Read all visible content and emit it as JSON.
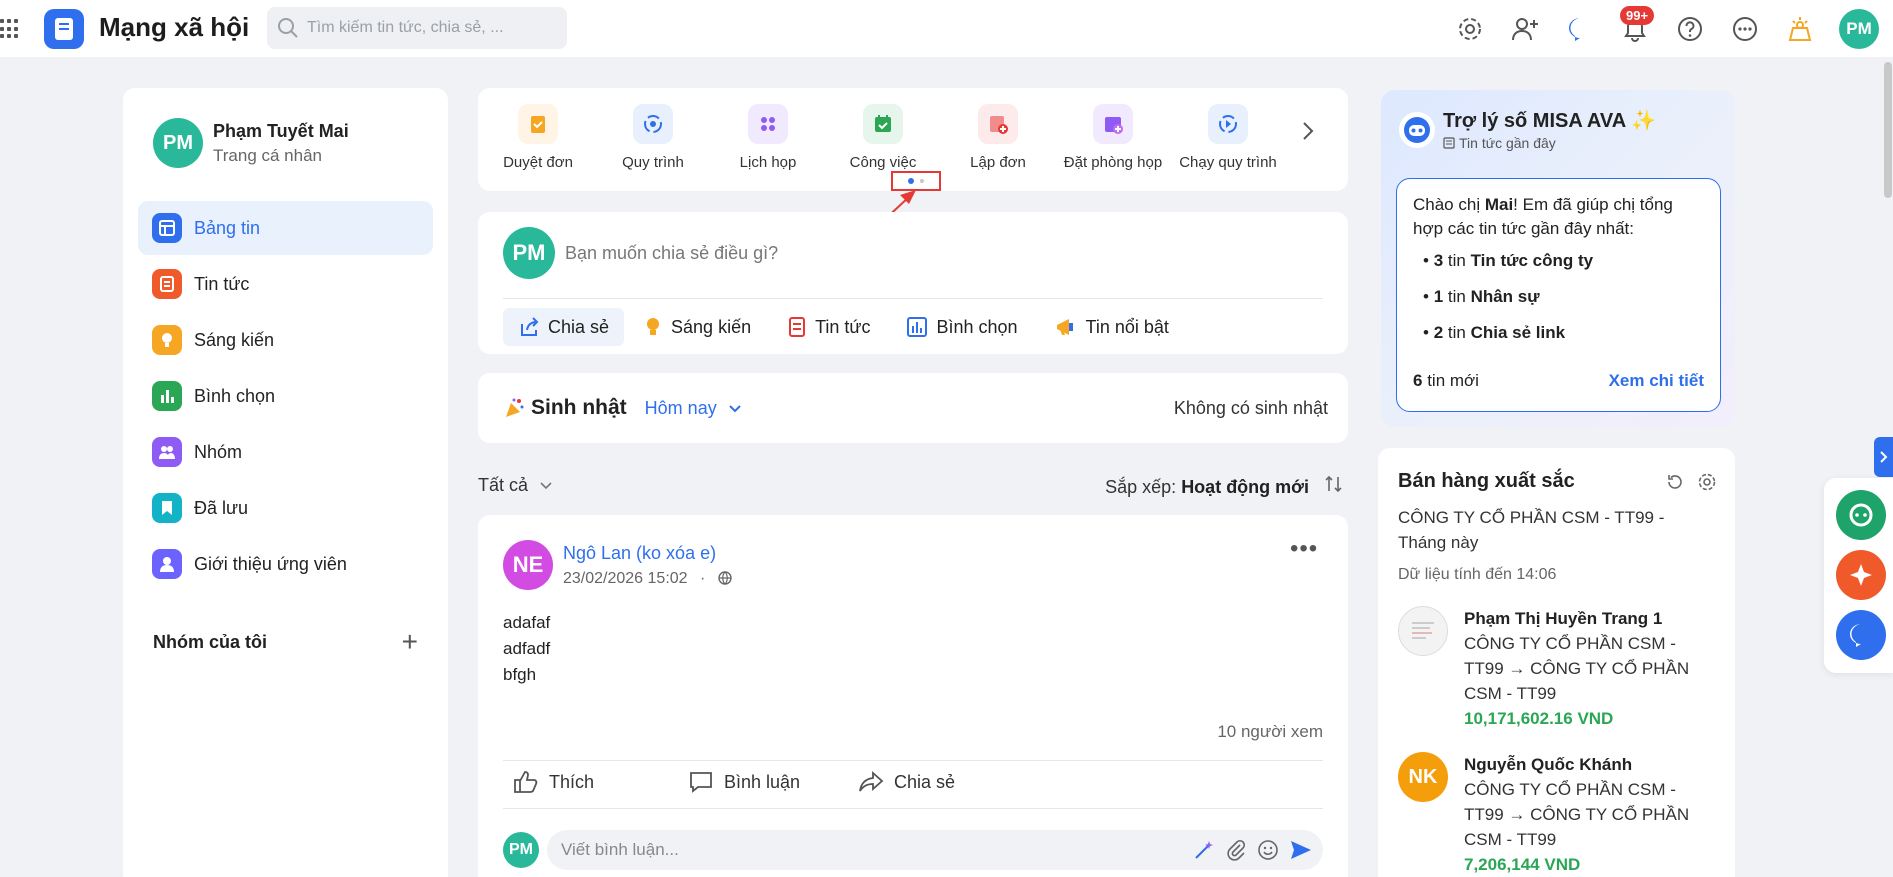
{
  "header": {
    "app_title": "Mạng xã hội",
    "search_placeholder": "Tìm kiếm tin tức, chia sẻ, ...",
    "notification_badge": "99+",
    "user_initials": "PM",
    "icons": [
      "apps-grid-icon",
      "settings-icon",
      "add-user-icon",
      "chat-icon",
      "bell-icon",
      "help-icon",
      "more-icon",
      "broadcast-icon"
    ]
  },
  "sidebar": {
    "profile": {
      "initials": "PM",
      "name": "Phạm Tuyết Mai",
      "subtitle": "Trang cá nhân"
    },
    "items": [
      {
        "label": "Bảng tin",
        "icon": "newsfeed-icon",
        "color": "#2f6fed",
        "active": true
      },
      {
        "label": "Tin tức",
        "icon": "news-icon",
        "color": "#f0592a"
      },
      {
        "label": "Sáng kiến",
        "icon": "idea-icon",
        "color": "#f5a623"
      },
      {
        "label": "Bình chọn",
        "icon": "poll-icon",
        "color": "#2aa655"
      },
      {
        "label": "Nhóm",
        "icon": "group-icon",
        "color": "#8e5cf5"
      },
      {
        "label": "Đã lưu",
        "icon": "bookmark-icon",
        "color": "#13b3c7"
      },
      {
        "label": "Giới thiệu ứng viên",
        "icon": "referral-icon",
        "color": "#6c63ff"
      }
    ],
    "groups_title": "Nhóm của tôi"
  },
  "quick_apps": [
    {
      "label": "Duyệt đơn",
      "icon": "approve-icon",
      "color": "#f5a623"
    },
    {
      "label": "Quy trình",
      "icon": "process-icon",
      "color": "#2f6fed"
    },
    {
      "label": "Lịch họp",
      "icon": "meeting-icon",
      "color": "#8e5cf5"
    },
    {
      "label": "Công việc",
      "icon": "task-icon",
      "color": "#2aa655"
    },
    {
      "label": "Lập đơn",
      "icon": "create-form-icon",
      "color": "#e53935"
    },
    {
      "label": "Đặt phòng họp",
      "icon": "book-room-icon",
      "color": "#8e5cf5"
    },
    {
      "label": "Chạy quy trình",
      "icon": "run-process-icon",
      "color": "#2f6fed"
    }
  ],
  "composer": {
    "initials": "PM",
    "placeholder": "Bạn muốn chia sẻ điều gì?",
    "actions": [
      {
        "label": "Chia sẻ",
        "icon": "share-icon"
      },
      {
        "label": "Sáng kiến",
        "icon": "idea-icon"
      },
      {
        "label": "Tin tức",
        "icon": "news-icon"
      },
      {
        "label": "Bình chọn",
        "icon": "poll-icon"
      },
      {
        "label": "Tin nổi bật",
        "icon": "highlight-icon"
      }
    ]
  },
  "birthday": {
    "title": "Sinh nhật",
    "selector": "Hôm nay",
    "empty": "Không có sinh nhật"
  },
  "filter": {
    "all": "Tất cả",
    "sort_label": "Sắp xếp:",
    "sort_value": "Hoạt động mới"
  },
  "post": {
    "initials": "NE",
    "author": "Ngô Lan (ko xóa e)",
    "datetime": "23/02/2026 15:02",
    "lines": [
      "adafaf",
      "adfadf",
      "bfgh"
    ],
    "viewers": "10 người xem",
    "actions": {
      "like": "Thích",
      "comment": "Bình luận",
      "share": "Chia sẻ"
    },
    "comment_initials": "PM",
    "comment_placeholder": "Viết bình luận..."
  },
  "assistant": {
    "title": "Trợ lý số MISA AVA ✨",
    "subtitle": "Tin tức gần đây",
    "greeting_pre": "Chào chị ",
    "greeting_name": "Mai",
    "greeting_post": "! Em đã giúp chị tổng hợp các tin tức gần đây nhất:",
    "items": [
      {
        "count": "3",
        "unit": " tin ",
        "label": "Tin tức công ty"
      },
      {
        "count": "1",
        "unit": " tin ",
        "label": "Nhân sự"
      },
      {
        "count": "2",
        "unit": " tin ",
        "label": "Chia sẻ link"
      }
    ],
    "new_count": "6",
    "new_label": " tin mới",
    "link": "Xem chi tiết"
  },
  "sales": {
    "title": "Bán hàng xuất sắc",
    "company": "CÔNG TY CỔ PHẦN CSM - TT99 - Tháng này",
    "updated": "Dữ liệu tính đến 14:06",
    "sellers": [
      {
        "initials": "",
        "name": "Phạm Thị Huyền Trang 1",
        "org": "CÔNG TY CỔ PHẦN CSM - TT99 → CÔNG TY CỔ PHẦN CSM - TT99",
        "amount": "10,171,602.16 VND"
      },
      {
        "initials": "NK",
        "name": "Nguyễn Quốc Khánh",
        "org": "CÔNG TY CỔ PHẦN CSM - TT99 → CÔNG TY CỔ PHẦN CSM - TT99",
        "amount": "7,206,144 VND"
      }
    ]
  }
}
